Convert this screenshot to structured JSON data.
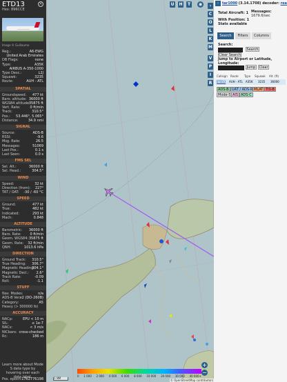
{
  "info": {
    "callsign": "ETD13",
    "hex_label": "Hex:",
    "hex": "896CCE",
    "photo_caption": "Image © Guillaume",
    "reg_fields": [
      {
        "k": "Reg.:",
        "v": "A6-EWG"
      },
      {
        "k": "",
        "v": "United Arab Emirates"
      },
      {
        "k": "DB Flags:",
        "v": "none"
      },
      {
        "k": "Type:",
        "v": "A35K"
      },
      {
        "k": "",
        "v": "AIRBUS A-350-1000"
      },
      {
        "k": "Type Desc.:",
        "v": "L2J"
      },
      {
        "k": "Squawk:",
        "v": "3235"
      },
      {
        "k": "Route:",
        "v": "AUH - ATL"
      }
    ],
    "sections": [
      {
        "title": "SPATIAL",
        "rows": [
          {
            "k": "Groundspeed:",
            "v": "477 kt"
          },
          {
            "k": "Baro. altitude:",
            "v": "36000 ft"
          },
          {
            "k": "WGS84 altitude:",
            "v": "35875 ft"
          },
          {
            "k": "Vert. Rate:",
            "v": "0 ft/min"
          },
          {
            "k": "Track:",
            "v": "310.5°"
          },
          {
            "k": "Pos.:",
            "v": "53.446°, 5.065°"
          },
          {
            "k": "Distance:",
            "v": "34.9 nmi"
          }
        ]
      },
      {
        "title": "SIGNAL",
        "rows": [
          {
            "k": "Source:",
            "v": "ADS-B"
          },
          {
            "k": "RSSI:",
            "v": "-9.6"
          },
          {
            "k": "Msg. Rate:",
            "v": "26.5"
          },
          {
            "k": "Messages:",
            "v": "51069"
          },
          {
            "k": "Last Pos.:",
            "v": "0.1 s"
          },
          {
            "k": "Last Seen:",
            "v": "0.0 s"
          }
        ]
      },
      {
        "title": "FMS SEL",
        "rows": [
          {
            "k": "Sel. Alt.:",
            "v": "36000 ft"
          },
          {
            "k": "Sel. Head.:",
            "v": "304.5°"
          }
        ]
      },
      {
        "title": "WIND",
        "rows": [
          {
            "k": "Speed:",
            "v": "32 kt"
          },
          {
            "k": "Direction (from):",
            "v": "227°"
          },
          {
            "k": "TAT / OAT:",
            "v": "-30 / -60 °C"
          }
        ]
      },
      {
        "title": "SPEED",
        "rows": [
          {
            "k": "Ground:",
            "v": "477 kt"
          },
          {
            "k": "True:",
            "v": "482 kt"
          },
          {
            "k": "Indicated:",
            "v": "293 kt"
          },
          {
            "k": "Mach:",
            "v": "0.848"
          }
        ]
      },
      {
        "title": "ALTITUDE",
        "rows": [
          {
            "k": "Barometric:",
            "v": "36000 ft"
          },
          {
            "k": "Baro. Rate:",
            "v": "0 ft/min"
          },
          {
            "k": "Geom. WGS84:",
            "v": "35875 ft"
          },
          {
            "k": "Geom. Rate:",
            "v": "32 ft/min"
          },
          {
            "k": "QNH:",
            "v": "1013.6 hPa"
          }
        ]
      },
      {
        "title": "DIRECTION",
        "rows": [
          {
            "k": "Ground Track:",
            "v": "310.5°"
          },
          {
            "k": "True Heading:",
            "v": "306.7°"
          },
          {
            "k": "Magnetic Heading:",
            "v": "304.1°"
          },
          {
            "k": "Magnetic Decl.:",
            "v": "2.6°"
          },
          {
            "k": "Track Rate:",
            "v": "-0.09"
          },
          {
            "k": "Roll:",
            "v": "-1.1"
          }
        ]
      },
      {
        "title": "STUFF",
        "rows": [
          {
            "k": "Nav. Modes:",
            "v": "n/a"
          },
          {
            "k": "ADS-B Ver.:",
            "v": "v2 (DO-260B)"
          },
          {
            "k": "Category:",
            "v": "A5"
          },
          {
            "k": "Heavy (> 300000 lb)",
            "v": ""
          }
        ]
      },
      {
        "title": "ACCURACY",
        "rows": [
          {
            "k": "NACp:",
            "v": "EPU < 10 m"
          },
          {
            "k": "SIL:",
            "v": "≤ 1e-7"
          },
          {
            "k": "NACv:",
            "v": "< 3 m/s"
          },
          {
            "k": "NICbaro:",
            "v": "cross-checked"
          },
          {
            "k": "Rc:",
            "v": "186 m"
          }
        ]
      }
    ],
    "note": "Learn more about Mode S data type by hovering over each data label.",
    "pos_epoch_label": "Pos. epoch:",
    "pos_epoch": "1762776198"
  },
  "map": {
    "top_buttons": [
      "U",
      "H",
      "T"
    ],
    "side_buttons": [
      "C",
      "O",
      "L",
      "K",
      "M",
      "V",
      "P",
      "I",
      "R"
    ],
    "altitude_ticks": [
      "0",
      "1 000",
      "2 000",
      "4 000",
      "6 000",
      "8 000",
      "10 000",
      "20 000",
      "30 000",
      "40 000+"
    ],
    "scale_label": "1 NM",
    "attribution": "© OpenStreetMap contributors",
    "zoom_in": "+",
    "zoom_out": "−"
  },
  "sidebar": {
    "version_link": "tar1090",
    "version_text": "(3.14.1708) decoder:",
    "decoder": "readsb",
    "total_label": "Total Aircraft:",
    "total": "1",
    "messages_label": "Messages:",
    "messages": "1679.6/sec",
    "with_pos_label": "With Position:",
    "with_pos": "1",
    "stats": "Stats available",
    "tabs": [
      "Search",
      "Filters",
      "Columns"
    ],
    "search_label": "Search:",
    "search_button": "Search",
    "clear_search": "Clear Search",
    "jump_label": "Jump to Airport or Latitude, Longitude:",
    "jump_button": "Jump",
    "clear_button": "Clear",
    "table_headers": [
      "Callsign",
      "Route",
      "Type",
      "Squawk",
      "Alt. (ft)"
    ],
    "table_row": [
      "ETD13",
      "AUH - ATL",
      "A35K",
      "3235",
      "36000"
    ],
    "chips_row1": [
      "ADS-B",
      "UAT / ADS-R",
      "MLAT",
      "TIS-B"
    ],
    "chips_row2": [
      "Mode-S",
      "AIS",
      "ADS-C"
    ]
  },
  "colors": {
    "accent": "#2d5f8b",
    "section": "#f08a4b",
    "track": "#a45cf0"
  }
}
